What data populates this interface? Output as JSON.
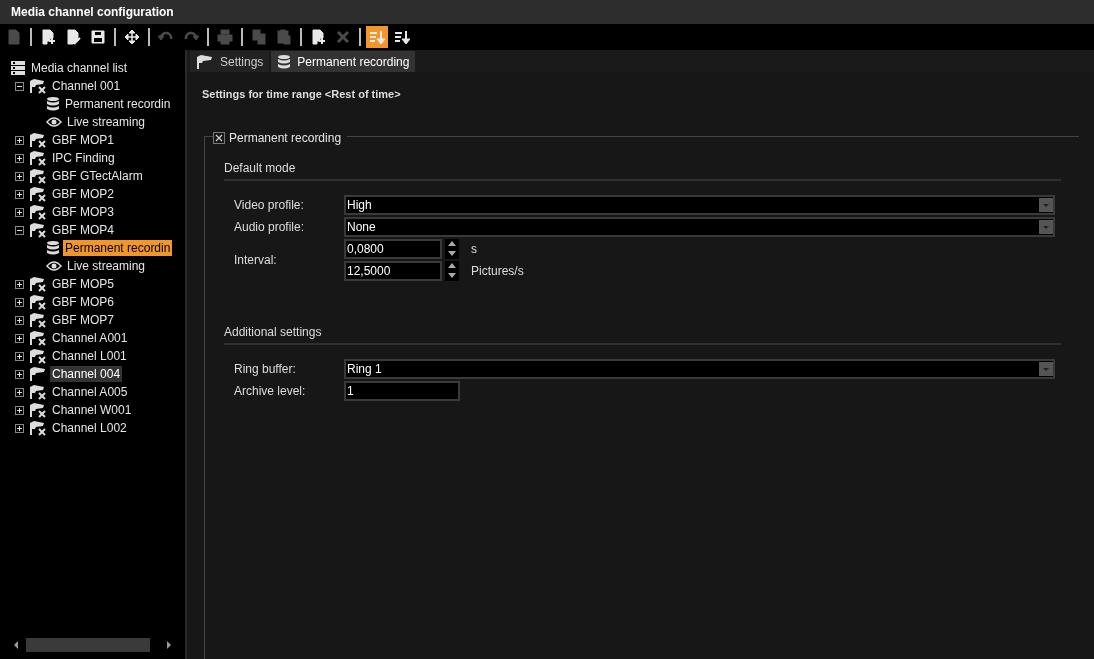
{
  "window": {
    "title": "Media channel configuration"
  },
  "toolbar": [
    [
      {
        "kind": "check",
        "disabled": true,
        "on": false
      }
    ],
    [
      {
        "kind": "newdoc",
        "disabled": false,
        "on": false
      },
      {
        "kind": "editdoc",
        "disabled": false,
        "on": false
      },
      {
        "kind": "save",
        "disabled": false,
        "on": false
      }
    ],
    [
      {
        "kind": "move",
        "disabled": false,
        "on": false
      }
    ],
    [
      {
        "kind": "undo",
        "disabled": true,
        "on": false
      },
      {
        "kind": "redo",
        "disabled": true,
        "on": false
      }
    ],
    [
      {
        "kind": "print",
        "disabled": true,
        "on": false
      }
    ],
    [
      {
        "kind": "copy",
        "disabled": true,
        "on": false
      },
      {
        "kind": "paste",
        "disabled": true,
        "on": false
      }
    ],
    [
      {
        "kind": "newdoc",
        "disabled": false,
        "on": false
      },
      {
        "kind": "delete",
        "disabled": true,
        "on": false
      }
    ],
    [
      {
        "kind": "sort",
        "disabled": false,
        "on": true
      },
      {
        "kind": "sort",
        "disabled": false,
        "on": false
      }
    ]
  ],
  "tree": {
    "label": "Media channel list",
    "kind": "list",
    "selected": false,
    "highlighted": false,
    "children": [
      {
        "label": "Channel 001",
        "kind": "camera",
        "expanded": true,
        "selected": false,
        "highlighted": false,
        "children": [
          {
            "label": "Permanent recordin",
            "kind": "recording",
            "selected": false,
            "highlighted": false
          },
          {
            "label": "Live streaming",
            "kind": "streaming",
            "selected": false,
            "highlighted": false
          }
        ]
      },
      {
        "label": "GBF MOP1",
        "kind": "camera",
        "expanded": false,
        "selected": false,
        "highlighted": false
      },
      {
        "label": "IPC Finding",
        "kind": "camera",
        "expanded": false,
        "selected": false,
        "highlighted": false
      },
      {
        "label": "GBF GTectAlarm",
        "kind": "camera",
        "expanded": false,
        "selected": false,
        "highlighted": false
      },
      {
        "label": "GBF MOP2",
        "kind": "camera",
        "expanded": false,
        "selected": false,
        "highlighted": false
      },
      {
        "label": "GBF MOP3",
        "kind": "camera",
        "expanded": false,
        "selected": false,
        "highlighted": false
      },
      {
        "label": "GBF MOP4",
        "kind": "camera",
        "expanded": true,
        "selected": false,
        "highlighted": false,
        "children": [
          {
            "label": "Permanent recordin",
            "kind": "recording",
            "selected": true,
            "highlighted": false
          },
          {
            "label": "Live streaming",
            "kind": "streaming",
            "selected": false,
            "highlighted": false
          }
        ]
      },
      {
        "label": "GBF MOP5",
        "kind": "camera",
        "expanded": false,
        "selected": false,
        "highlighted": false
      },
      {
        "label": "GBF MOP6",
        "kind": "camera",
        "expanded": false,
        "selected": false,
        "highlighted": false
      },
      {
        "label": "GBF MOP7",
        "kind": "camera",
        "expanded": false,
        "selected": false,
        "highlighted": false
      },
      {
        "label": "Channel A001",
        "kind": "camera",
        "expanded": false,
        "selected": false,
        "highlighted": false
      },
      {
        "label": "Channel L001",
        "kind": "camera",
        "expanded": false,
        "selected": false,
        "highlighted": false
      },
      {
        "label": "Channel 004",
        "kind": "cameraon",
        "expanded": false,
        "selected": false,
        "highlighted": true
      },
      {
        "label": "Channel A005",
        "kind": "camera",
        "expanded": false,
        "selected": false,
        "highlighted": false
      },
      {
        "label": "Channel W001",
        "kind": "camera",
        "expanded": false,
        "selected": false,
        "highlighted": false
      },
      {
        "label": "Channel L002",
        "kind": "camera",
        "expanded": false,
        "selected": false,
        "highlighted": false
      }
    ]
  },
  "tabs": [
    {
      "label": "Settings",
      "kind": "cameraon",
      "selected": false
    },
    {
      "label": "Permanent recording",
      "kind": "recording",
      "selected": true
    }
  ],
  "heading": "Settings for time range <Rest of time>",
  "group": {
    "label": "Permanent recording",
    "checked": true,
    "sections": [
      {
        "title": "Default mode",
        "rows": [
          {
            "kind": "dropdown",
            "label": "Video profile:",
            "value": "High"
          },
          {
            "kind": "dropdown",
            "label": "Audio profile:",
            "value": "None"
          },
          {
            "kind": "spinners",
            "label": "Interval:",
            "spinners": [
              {
                "value": "0,0800",
                "unit": "s"
              },
              {
                "value": "12,5000",
                "unit": "Pictures/s"
              }
            ]
          }
        ]
      },
      {
        "title": "Additional settings",
        "rows": [
          {
            "kind": "dropdown",
            "label": "Ring buffer:",
            "value": "Ring 1"
          },
          {
            "kind": "text",
            "label": "Archive level:",
            "value": "1"
          }
        ]
      }
    ]
  }
}
